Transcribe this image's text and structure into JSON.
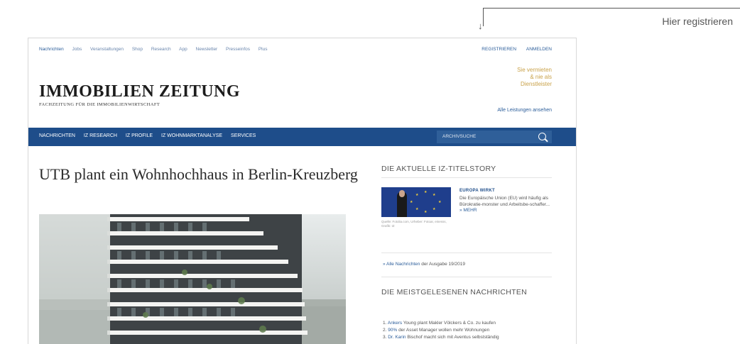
{
  "annotation": {
    "label": "Hier registrieren"
  },
  "top_nav": {
    "left_items": [
      "Nachrichten",
      "Jobs",
      "Veranstaltungen",
      "Shop",
      "Research",
      "App",
      "Newsletter",
      "Presseinfos",
      "Plus"
    ],
    "right_items": [
      "REGISTRIEREN",
      "ANMELDEN"
    ]
  },
  "promo": {
    "lines": [
      "Sie vermieten",
      "& nie als",
      "Dienstleister"
    ],
    "link": "Alle Leistungen ansehen"
  },
  "logo": {
    "title": "IMMOBILIEN ZEITUNG",
    "subtitle": "FACHZEITUNG FÜR DIE IMMOBILIENWIRTSCHAFT"
  },
  "main_nav": {
    "items": [
      "NACHRICHTEN",
      "IZ RESEARCH",
      "IZ PROFILE",
      "IZ WOHNMARKTANALYSE",
      "SERVICES"
    ],
    "search_label": "ARCHIVSUCHE"
  },
  "article": {
    "headline": "UTB plant ein Wohnhochhaus in Berlin-Kreuzberg"
  },
  "sidebar": {
    "titlestory_heading": "DIE AKTUELLE IZ-TITELSTORY",
    "story_title": "EUROPA WIRKT",
    "story_text": "Die Europäische Union (EU) wird häufig als Bürokratie-monster und Arbeitsbe-schaffer...",
    "story_more": "» MEHR",
    "cover_caption": "Quelle: Fotolia.com, Urheber: Fotoar, einesss, Grafik: IZ",
    "issue_link_label": "» Alle Nachrichten",
    "issue_link_suffix": "der Ausgabe 19/2019",
    "mostread_heading": "DIE MEISTGELESENEN NACHRICHTEN",
    "mostread": [
      {
        "num": "1.",
        "highlight": "Ankers",
        "text": "Young plant Makler Völckers & Co. zu kaufen"
      },
      {
        "num": "2.",
        "highlight": "90%",
        "text": "der Asset Manager wollen mehr Wohnungen"
      },
      {
        "num": "3.",
        "highlight": "Dr. Karin",
        "text": "Bischof macht sich mit Aventus selbstständig"
      }
    ]
  }
}
